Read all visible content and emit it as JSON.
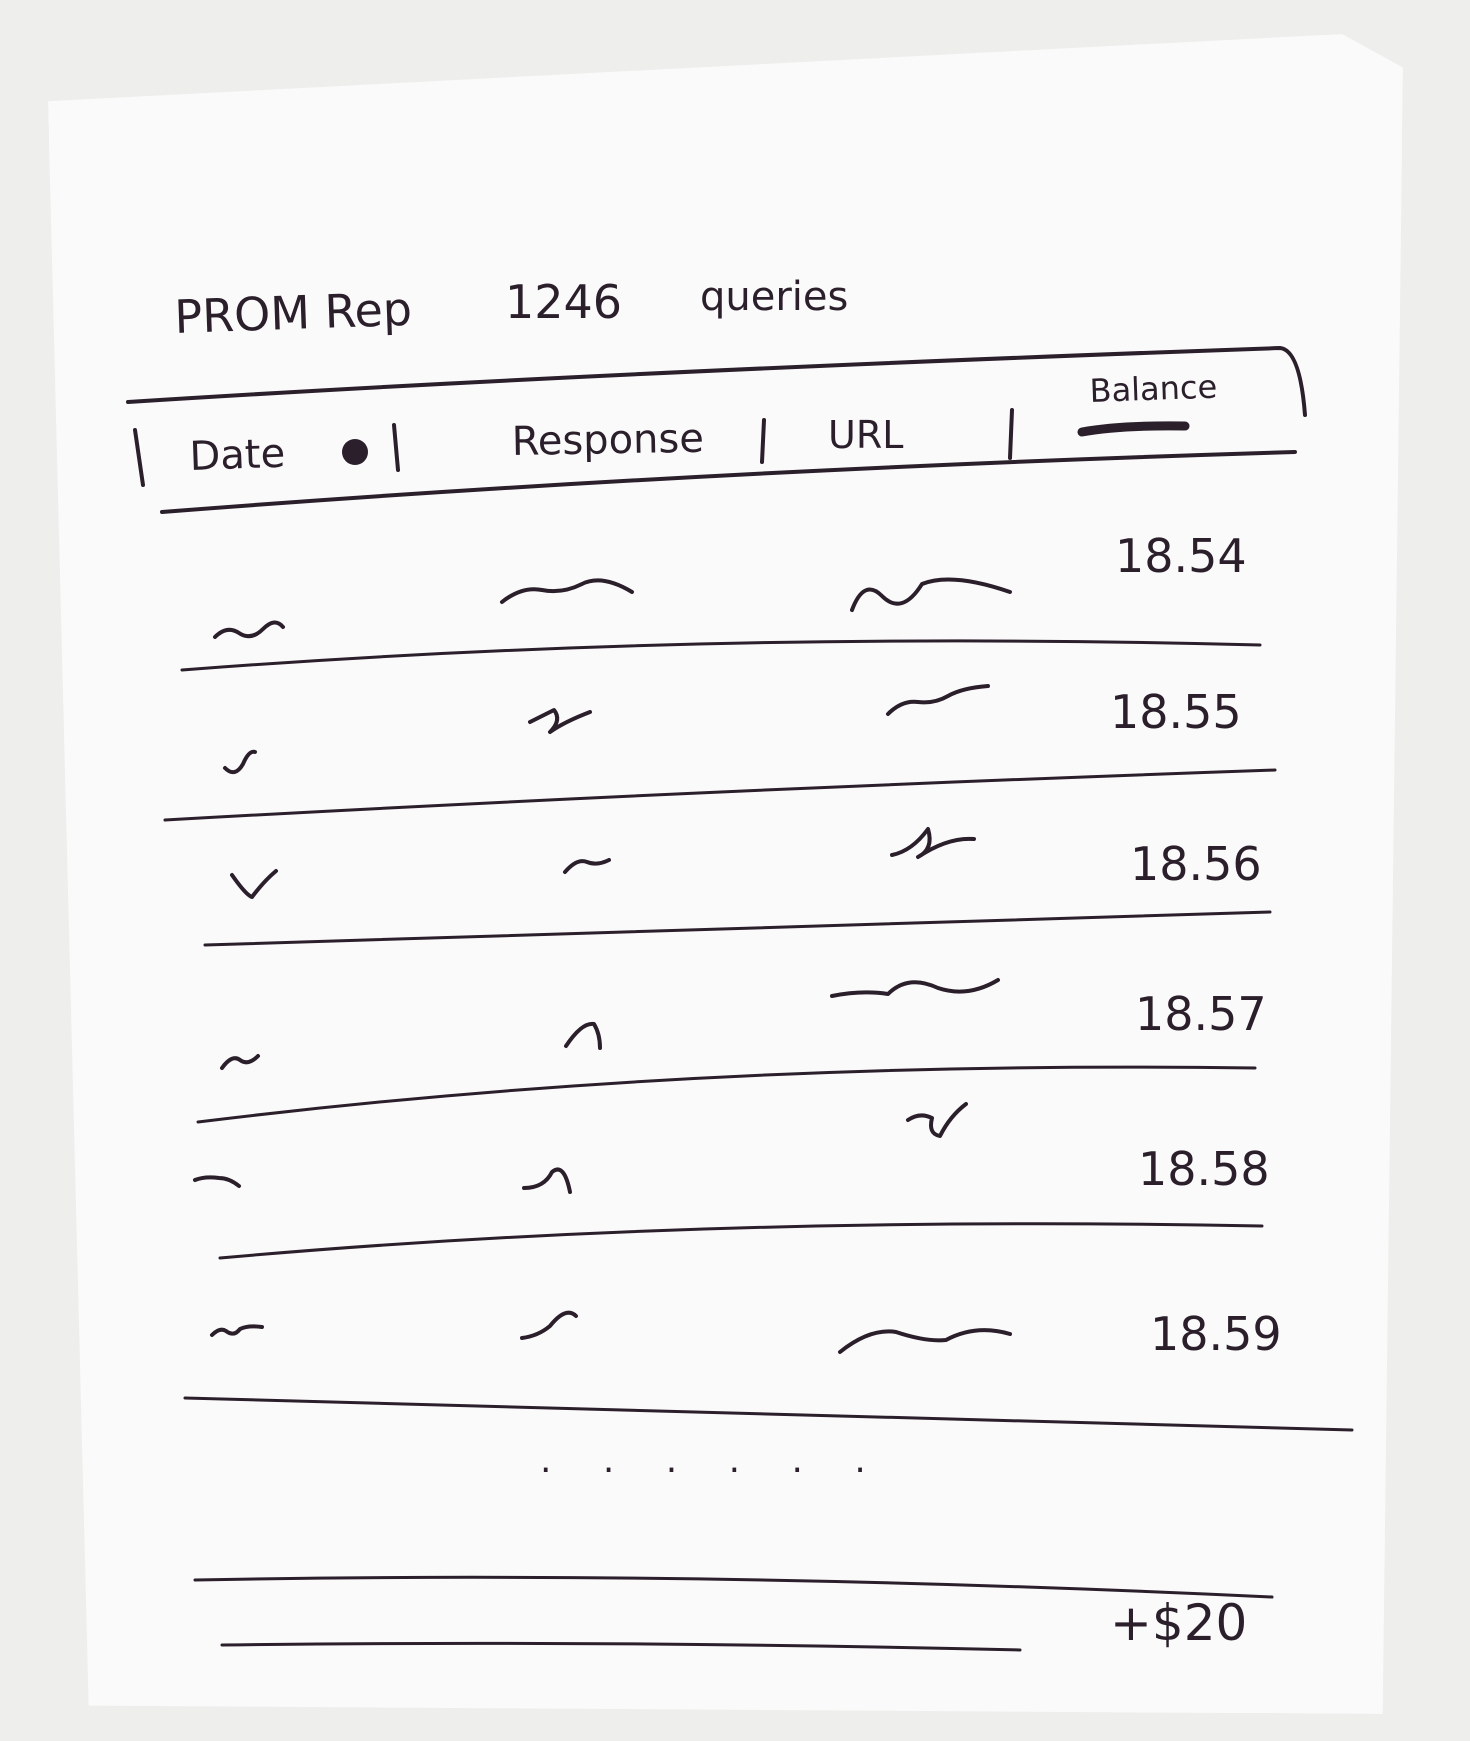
{
  "header": {
    "title": "PROM Rep",
    "count": "1246",
    "count_label": "queries"
  },
  "table": {
    "columns": [
      "Date",
      "Response",
      "URL",
      "Balance"
    ],
    "balances": [
      "18.54",
      "18.55",
      "18.56",
      "18.57",
      "18.58",
      "18.59"
    ],
    "ellipsis": ". . . . . .",
    "total": "+$20"
  }
}
